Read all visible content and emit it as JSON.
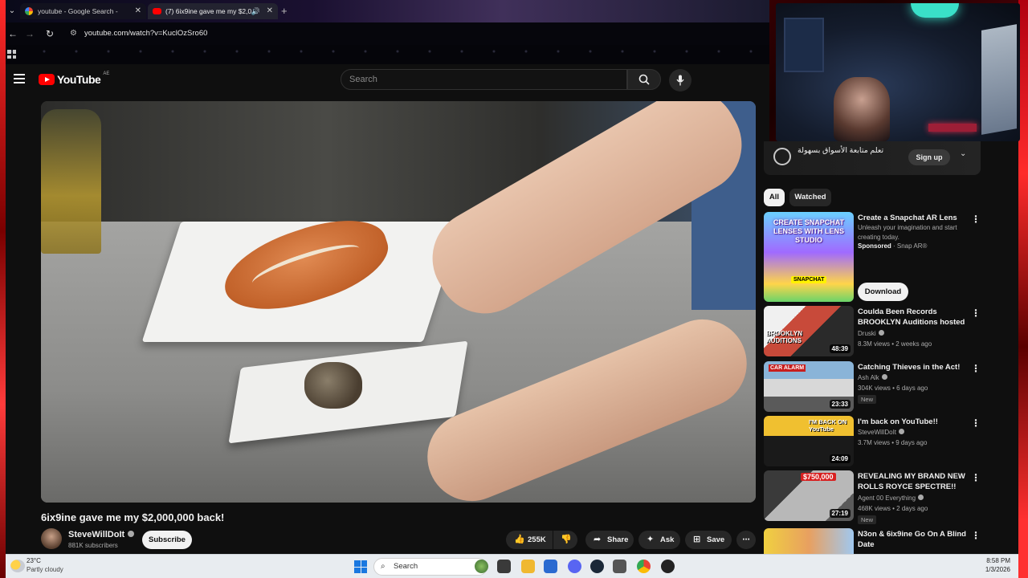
{
  "browser": {
    "tabs": [
      {
        "label": "youtube - Google Search -"
      },
      {
        "label": "(7) 6ix9ine gave me my $2,0"
      }
    ],
    "url": "youtube.com/watch?v=KuclOzSro60"
  },
  "youtube": {
    "logo_text": "YouTube",
    "country_code": "AE",
    "search_placeholder": "Search",
    "video": {
      "title": "6ix9ine gave me my $2,000,000 back!",
      "channel": "SteveWillDoIt",
      "subscribers": "881K subscribers",
      "subscribe_label": "Subscribe",
      "likes": "255K",
      "share_label": "Share",
      "ask_label": "Ask",
      "save_label": "Save"
    },
    "banner": {
      "text": "تعلم متابعة الأسواق بسهولة",
      "button": "Sign up"
    },
    "chips": [
      "All",
      "Watched"
    ],
    "ad": {
      "title": "Create a Snapchat AR Lens",
      "description": "Unleash your imagination and start creating today.",
      "sponsored": "Sponsored",
      "advertiser": "Snap AR®",
      "button": "Download",
      "thumb_text": "CREATE SNAPCHAT LENSES WITH LENS STUDIO",
      "thumb_badge": "SNAPCHAT"
    },
    "recommendations": [
      {
        "title": "Coulda Been Records BROOKLYN Auditions hosted b...",
        "channel": "Druski",
        "meta": "8.3M views • 2 weeks ago",
        "duration": "48:39",
        "badge": "",
        "thumb_text": "BROOKLYN AUDITIONS"
      },
      {
        "title": "Catching Thieves in the Act!",
        "channel": "Ash Alk",
        "meta": "304K views • 6 days ago",
        "duration": "23:33",
        "badge": "New",
        "thumb_text": "CAR ALARM"
      },
      {
        "title": "I'm back on YouTube!!",
        "channel": "SteveWillDoIt",
        "meta": "3.7M views • 9 days ago",
        "duration": "24:09",
        "badge": "",
        "thumb_text": "I'M BACK ON YouTube"
      },
      {
        "title": "REVEALING MY BRAND NEW ROLLS ROYCE SPECTRE!!",
        "channel": "Agent 00 Everything",
        "meta": "468K views • 2 days ago",
        "duration": "27:19",
        "badge": "New",
        "thumb_text": "$750,000"
      },
      {
        "title": "N3on & 6ix9ine Go On A Blind Date",
        "channel": "",
        "meta": "",
        "duration": "",
        "badge": "",
        "thumb_text": ""
      }
    ]
  },
  "taskbar": {
    "temperature": "23°C",
    "weather": "Partly cloudy",
    "search_label": "Search",
    "time": "8:58 PM",
    "date": "1/3/2026"
  },
  "icons": [
    "chevron-down-icon",
    "google-icon",
    "youtube-icon",
    "speaker-icon",
    "close-icon",
    "plus-icon",
    "back-icon",
    "forward-icon",
    "reload-icon",
    "tune-icon",
    "apps-icon",
    "menu-icon",
    "search-icon",
    "mic-icon",
    "verified-icon",
    "like-icon",
    "dislike-icon",
    "share-icon",
    "sparkle-icon",
    "save-icon",
    "more-icon",
    "windows-icon"
  ]
}
